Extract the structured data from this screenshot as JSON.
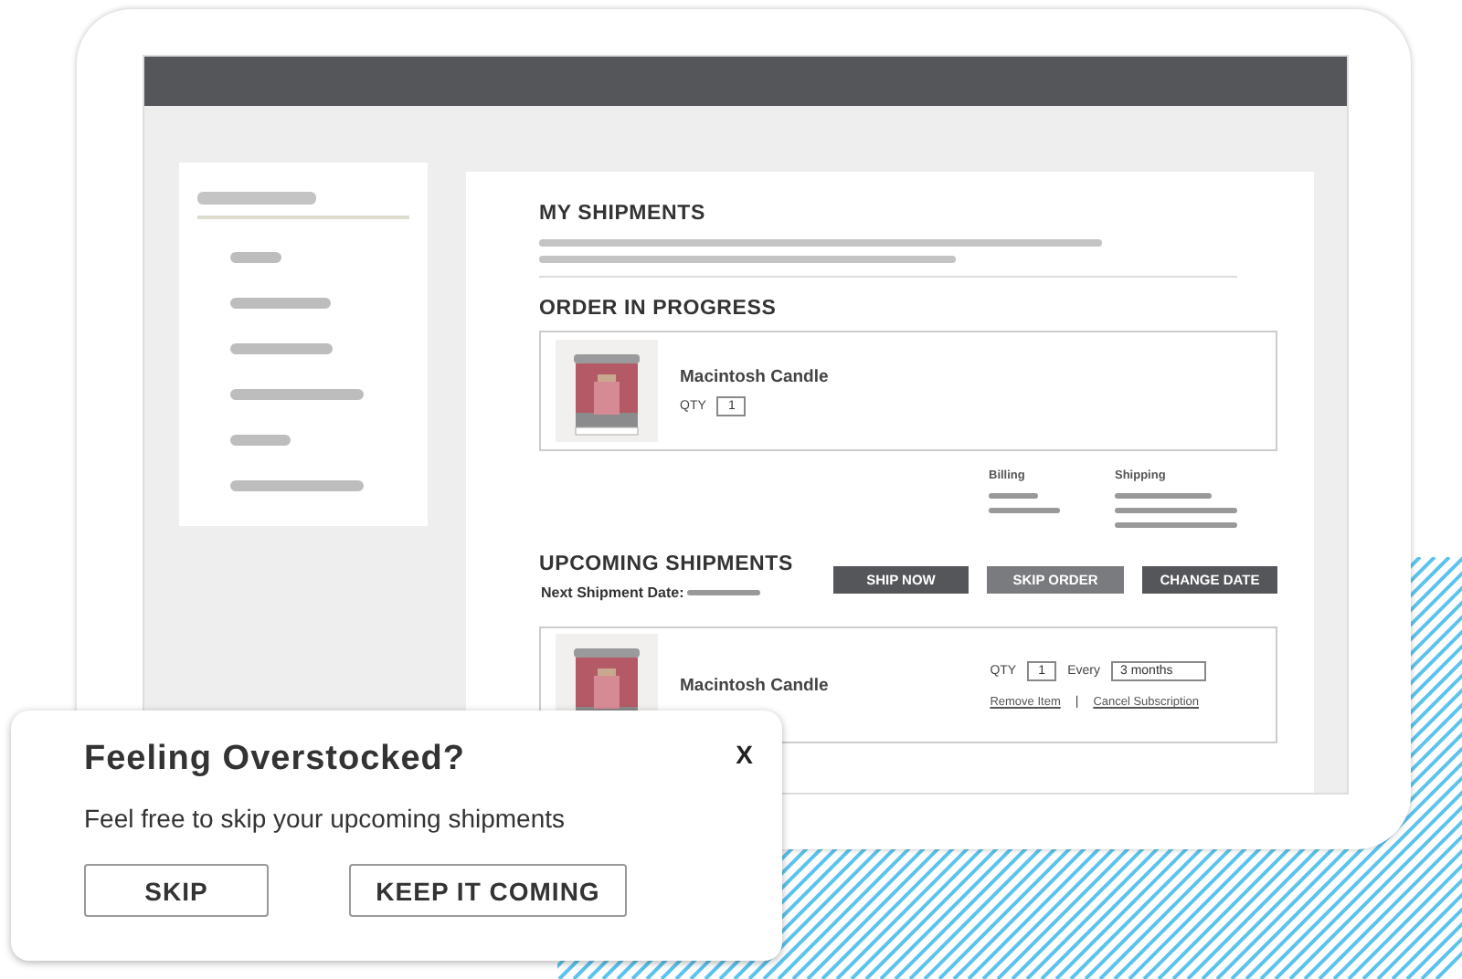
{
  "page": {
    "title": "MY SHIPMENTS"
  },
  "order_in_progress": {
    "heading": "ORDER IN PROGRESS",
    "item": {
      "name": "Macintosh Candle",
      "qty_label": "QTY",
      "qty": "1"
    },
    "billing_label": "Billing",
    "shipping_label": "Shipping"
  },
  "upcoming": {
    "heading": "UPCOMING SHIPMENTS",
    "next_date_label": "Next Shipment Date:",
    "buttons": [
      {
        "label": "SHIP NOW",
        "kind": "dark"
      },
      {
        "label": "SKIP ORDER",
        "kind": "medium"
      },
      {
        "label": "CHANGE DATE",
        "kind": "dark"
      }
    ],
    "item": {
      "name": "Macintosh Candle",
      "qty_label": "QTY",
      "qty": "1",
      "every_label": "Every",
      "frequency": "3 months",
      "links": [
        "Remove Item",
        "Cancel Subscription"
      ],
      "separator": "|"
    }
  },
  "popup": {
    "title": "Feeling Overstocked?",
    "close": "X",
    "message": "Feel free to skip your upcoming shipments",
    "buttons": [
      "SKIP",
      "KEEP IT COMING"
    ]
  }
}
